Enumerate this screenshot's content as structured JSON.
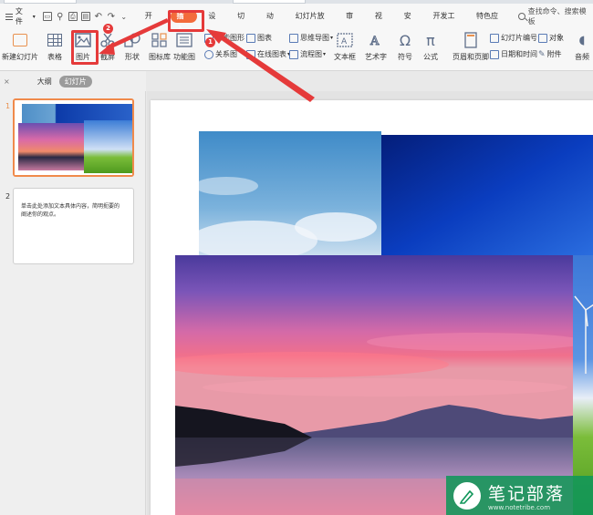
{
  "menubar": {
    "file_label": "文件",
    "tabs": [
      {
        "label": "开始"
      },
      {
        "label": "插入"
      },
      {
        "label": "设计"
      },
      {
        "label": "切换"
      },
      {
        "label": "动画"
      },
      {
        "label": "幻灯片放映"
      },
      {
        "label": "审阅"
      },
      {
        "label": "视图"
      },
      {
        "label": "安全"
      },
      {
        "label": "开发工具"
      },
      {
        "label": "特色应用"
      }
    ],
    "search_label": "查找命令、搜索模板"
  },
  "ribbon": {
    "new_slide": "新建幻灯片",
    "table": "表格",
    "picture": "图片",
    "screenshot": "截屏",
    "shape": "形状",
    "icon_library": "图标库",
    "function_chart": "功能图",
    "smart_graphic": "智能图形",
    "relation": "关系图",
    "chart": "图表",
    "online_chart": "在线图表",
    "mind_map": "思维导图",
    "flowchart": "流程图",
    "textbox": "文本框",
    "art_text": "艺术字",
    "symbol": "符号",
    "formula": "公式",
    "header_footer": "页眉和页脚",
    "slide_number": "幻灯片编号",
    "date_time": "日期和时间",
    "object": "对象",
    "attachment": "附件",
    "audio": "音频"
  },
  "pane": {
    "close": "×",
    "outline_tab": "大纲",
    "slides_tab": "幻灯片"
  },
  "slides": [
    {
      "num": "1"
    },
    {
      "num": "2",
      "text": "单击此处添加文本具体内容，简明扼要的阐述你的观点。"
    }
  ],
  "annotations": {
    "step1": "1",
    "step2": "2"
  },
  "watermark": {
    "title": "笔记部落",
    "url": "www.notetribe.com"
  },
  "colors": {
    "accent": "#f36b3b",
    "annotation_red": "#e53a3a",
    "watermark_green": "#10965a"
  }
}
